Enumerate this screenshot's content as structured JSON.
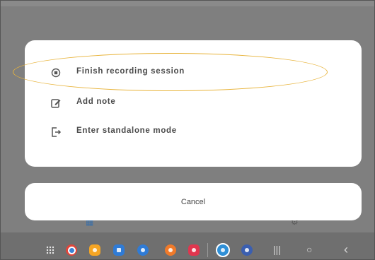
{
  "menu": {
    "items": [
      {
        "icon": "stop-circle-icon",
        "label": "Finish recording session"
      },
      {
        "icon": "edit-note-icon",
        "label": "Add note"
      },
      {
        "icon": "exit-to-app-icon",
        "label": "Enter standalone mode"
      }
    ]
  },
  "cancel_label": "Cancel",
  "highlight_color": "#e8b43c",
  "taskbar": {
    "apps": [
      {
        "icon": "app-drawer-icon",
        "color": "#6f6f6f"
      },
      {
        "icon": "chrome-icon",
        "color": "#e0453a"
      },
      {
        "icon": "files-icon",
        "color": "#f5a524"
      },
      {
        "icon": "calendar-icon",
        "color": "#2f7bd6"
      },
      {
        "icon": "messages-icon",
        "color": "#2f7bd6"
      },
      {
        "icon": "contacts-icon",
        "color": "#f07a2a"
      },
      {
        "icon": "screen-recorder-icon",
        "color": "#e0364e"
      },
      {
        "icon": "app-icon",
        "color": "#2f8fd6"
      },
      {
        "icon": "settings-icon",
        "color": "#3b5fb0"
      }
    ],
    "nav": [
      {
        "icon": "recent-apps-icon",
        "glyph": "|||"
      },
      {
        "icon": "home-icon",
        "glyph": "○"
      },
      {
        "icon": "back-icon",
        "glyph": "‹"
      }
    ]
  }
}
